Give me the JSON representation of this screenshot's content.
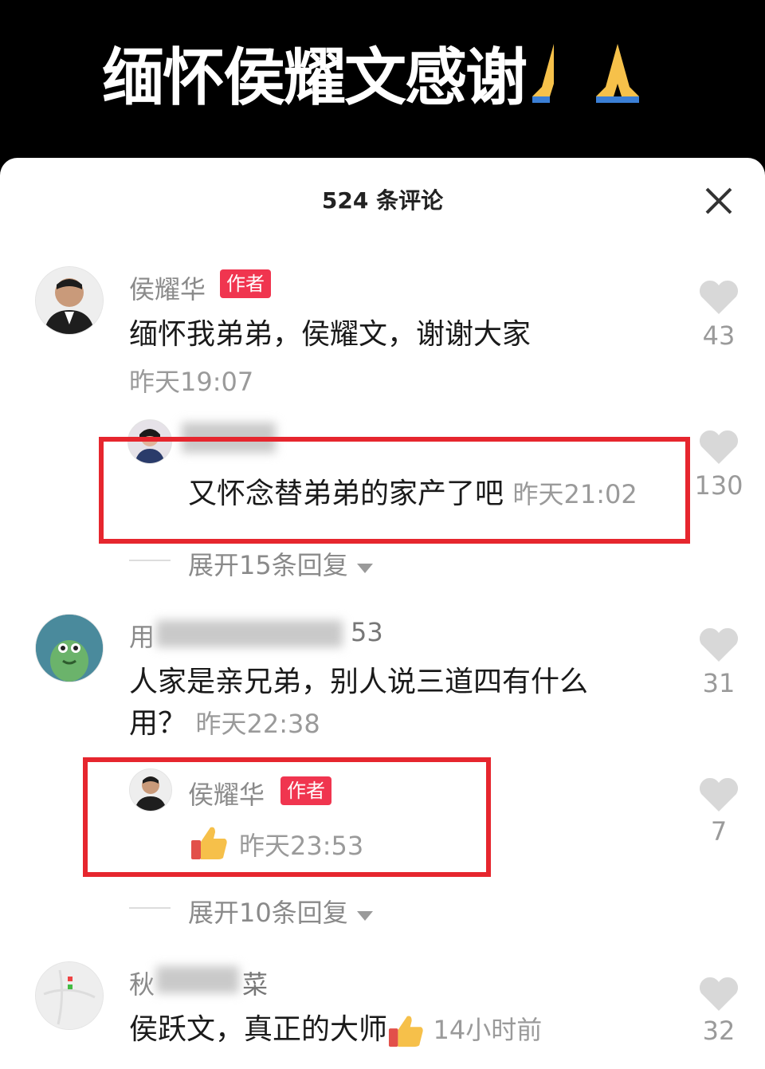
{
  "banner": {
    "title": "缅怀侯耀文感谢"
  },
  "header": {
    "count_title": "524 条评论"
  },
  "comments": [
    {
      "name": "侯耀华",
      "badge": "作者",
      "text": "缅怀我弟弟，侯耀文，谢谢大家",
      "time": "昨天19:07",
      "likes": "43"
    },
    {
      "reply_text": "又怀念替弟弟的家产了吧",
      "reply_time": "昨天21:02",
      "reply_likes": "130",
      "expand": "展开15条回复"
    },
    {
      "name_prefix": "用",
      "name_suffix": "53",
      "text_line1": "人家是亲兄弟，别人说三道四有什么",
      "text_line2": "用？",
      "time": "昨天22:38",
      "likes": "31"
    },
    {
      "reply_name": "侯耀华",
      "reply_badge": "作者",
      "reply_time": "昨天23:53",
      "reply_likes": "7",
      "expand": "展开10条回复"
    },
    {
      "name_prefix": "秋",
      "name_suffix": "菜",
      "text": "侯跃文，真正的大师",
      "time": "14小时前",
      "likes": "32"
    }
  ],
  "colors": {
    "author_badge": "#f0354f",
    "highlight_box": "#e6262e",
    "muted_text": "#9a9a9a"
  }
}
